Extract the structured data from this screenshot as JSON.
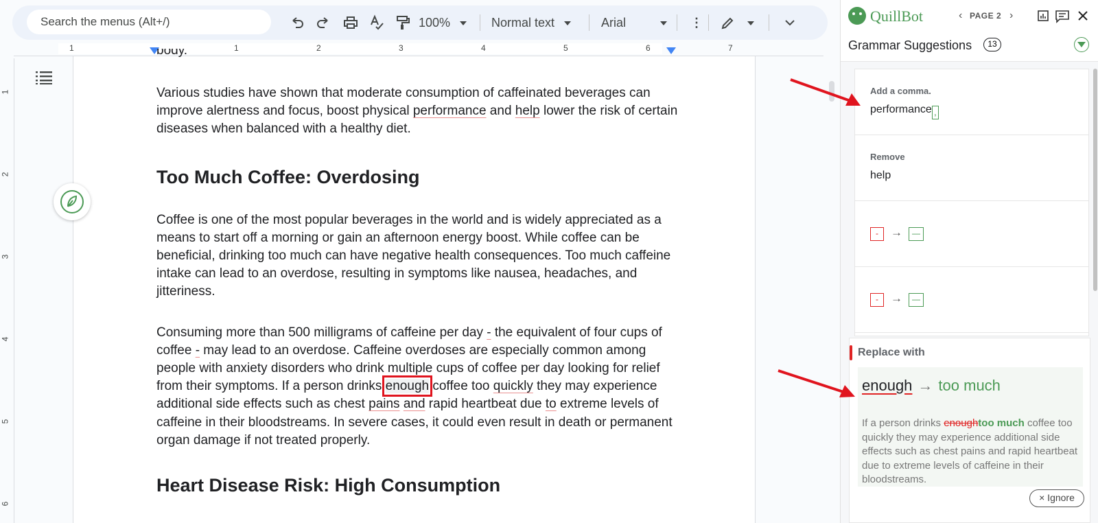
{
  "toolbar": {
    "search_placeholder": "Search the menus (Alt+/)",
    "zoom": "100%",
    "style": "Normal text",
    "font": "Arial"
  },
  "ruler": {
    "h_ticks": [
      "1",
      "1",
      "2",
      "3",
      "4",
      "5",
      "6",
      "7"
    ],
    "v_ticks": [
      "1",
      "2",
      "3",
      "4",
      "5",
      "6"
    ]
  },
  "doc": {
    "top_fragment": "body.",
    "p1": {
      "a": "Various studies have shown that moderate consumption of caffeinated beverages can improve alertness and focus, boost physical ",
      "u1": "performance",
      "b": " and ",
      "u2": "help",
      "c": " lower the risk of certain diseases when balanced with a healthy diet."
    },
    "h1": "Too Much Coffee: Overdosing",
    "p2": "Coffee is one of the most popular beverages in the world and is widely appreciated as a means to start off a morning or gain an afternoon energy boost. While coffee can be beneficial, drinking too much can have negative health consequences. Too much caffeine intake can lead to an overdose, resulting in symptoms like nausea, headaches, and jitteriness.",
    "p3": {
      "a": "Consuming more than 500 milligrams of caffeine per day ",
      "dash1": "-",
      "b": " the equivalent of four cups of coffee ",
      "dash2": "-",
      "c": " may lead to an overdose. Caffeine overdoses are especially common among people with anxiety disorders who drink multiple cups of coffee per day looking for relief from their symptoms. If a person drinks ",
      "highlight": "enough",
      "d": " coffee too ",
      "u_quickly": "quickly",
      "e": " they may experience additional side effects such as chest ",
      "u_pains": "pains",
      "f": " ",
      "u_and": "and",
      "g": " rapid heartbeat due ",
      "u_to": "to",
      "h": " extreme levels of caffeine in their bloodstreams. In severe cases, it could even result in death or permanent organ damage if not treated properly."
    },
    "h2": "Heart Disease Risk: High Consumption"
  },
  "panel": {
    "brand": "QuillBot",
    "page_label": "PAGE 2",
    "title": "Grammar Suggestions",
    "count": "13",
    "cards": [
      {
        "title": "Add a comma.",
        "text": "performance",
        "insert": ","
      },
      {
        "title": "Remove",
        "text": "help"
      },
      {
        "del": "-",
        "ins": "—"
      },
      {
        "del": "-",
        "ins": "—"
      }
    ],
    "detail": {
      "title": "Replace with",
      "old": "enough",
      "new": "too much",
      "ex_a": "If a person drinks ",
      "ex_strike": "enough",
      "ex_add": "too much",
      "ex_b": " coffee too quickly they may experience additional side effects such as chest pains and rapid heartbeat due to extreme levels of caffeine in their bloodstreams.",
      "ignore": "× Ignore"
    }
  },
  "colors": {
    "accent_green": "#4b9a55",
    "error_red": "#e02424",
    "annotation_red": "#e0141e"
  }
}
